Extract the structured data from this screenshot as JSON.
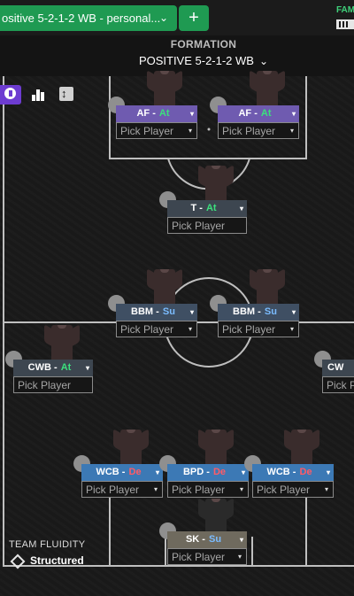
{
  "header": {
    "tab_title": "ositive 5-2-1-2 WB - personal...",
    "tab_chevron": "⌄",
    "add_label": "+",
    "corner_text": "FAM"
  },
  "formation": {
    "label": "FORMATION",
    "selected": "POSITIVE 5-2-1-2 WB",
    "chevron": "⌄"
  },
  "toolbar": {
    "icons": [
      "person-icon",
      "stats-bar-icon",
      "swap-icon"
    ]
  },
  "pick_placeholder": "Pick Player",
  "dropdown_glyph": "▾",
  "positions": [
    {
      "role": "AF",
      "duty": "At"
    },
    {
      "role": "AF",
      "duty": "At"
    },
    {
      "role": "T",
      "duty": "At"
    },
    {
      "role": "BBM",
      "duty": "Su"
    },
    {
      "role": "BBM",
      "duty": "Su"
    },
    {
      "role": "CWB",
      "duty": "At"
    },
    {
      "role": "CW",
      "duty": ""
    },
    {
      "role": "WCB",
      "duty": "De"
    },
    {
      "role": "BPD",
      "duty": "De"
    },
    {
      "role": "WCB",
      "duty": "De"
    },
    {
      "role": "SK",
      "duty": "Su"
    }
  ],
  "fluidity": {
    "label": "TEAM FLUIDITY",
    "value": "Structured"
  },
  "colors": {
    "attack_role_bg": "#6f5bb0",
    "striker_role_bg": "#3d4650",
    "support_role_bg": "#3f4f63",
    "defend_role_bg": "#3c79b5",
    "keeper_role_bg": "#6f6a5e",
    "attack": "#3ce07d",
    "support": "#7bbcff",
    "defend": "#ff5b66",
    "tab_green": "#1f9a52"
  }
}
